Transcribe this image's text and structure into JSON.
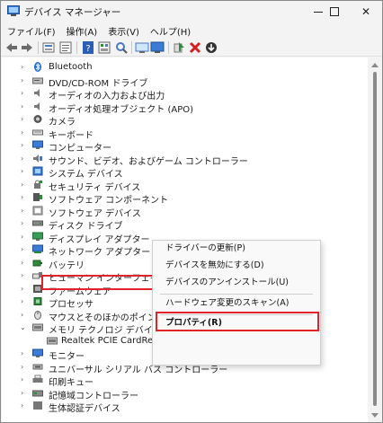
{
  "window": {
    "title": "デバイス マネージャー",
    "min_label": "—",
    "max_label": "□",
    "close_label": "✕"
  },
  "menubar": {
    "items": [
      "ファイル(F)",
      "操作(A)",
      "表示(V)",
      "ヘルプ(H)"
    ]
  },
  "toolbar": {
    "icons": [
      "back-arrow-icon",
      "forward-arrow-icon",
      "device-view-icon",
      "properties-icon",
      "help-icon",
      "resources-icon",
      "scan-hardware-icon",
      "monitor-icon",
      "enable-device-icon",
      "uninstall-icon",
      "update-driver-icon"
    ]
  },
  "tree": {
    "items": [
      {
        "label": "Bluetooth",
        "icon": "bluetooth-icon",
        "expanded": false
      },
      {
        "label": "DVD/CD-ROM ドライブ",
        "icon": "dvd-drive-icon",
        "expanded": false
      },
      {
        "label": "オーディオの入力および出力",
        "icon": "speaker-icon",
        "expanded": false
      },
      {
        "label": "オーディオ処理オブジェクト (APO)",
        "icon": "speaker-icon",
        "expanded": false
      },
      {
        "label": "カメラ",
        "icon": "camera-icon",
        "expanded": false
      },
      {
        "label": "キーボード",
        "icon": "keyboard-icon",
        "expanded": false
      },
      {
        "label": "コンピューター",
        "icon": "computer-icon",
        "expanded": false
      },
      {
        "label": "サウンド、ビデオ、およびゲーム コントローラー",
        "icon": "sound-video-icon",
        "expanded": false
      },
      {
        "label": "システム デバイス",
        "icon": "system-device-icon",
        "expanded": false
      },
      {
        "label": "セキュリティ デバイス",
        "icon": "security-device-icon",
        "expanded": false
      },
      {
        "label": "ソフトウェア コンポーネント",
        "icon": "software-component-icon",
        "expanded": false
      },
      {
        "label": "ソフトウェア デバイス",
        "icon": "software-device-icon",
        "expanded": false
      },
      {
        "label": "ディスク ドライブ",
        "icon": "disk-drive-icon",
        "expanded": false
      },
      {
        "label": "ディスプレイ アダプター",
        "icon": "display-adapter-icon",
        "expanded": false
      },
      {
        "label": "ネットワーク アダプター",
        "icon": "network-adapter-icon",
        "expanded": false
      },
      {
        "label": "バッテリ",
        "icon": "battery-icon",
        "expanded": false
      },
      {
        "label": "ヒューマン インターフェイス デバイ",
        "icon": "hid-icon",
        "expanded": false
      },
      {
        "label": "ファームウェア",
        "icon": "firmware-icon",
        "expanded": false
      },
      {
        "label": "プロセッサ",
        "icon": "processor-icon",
        "expanded": false
      },
      {
        "label": "マウスとそのほかのポインティン",
        "icon": "mouse-icon",
        "expanded": false
      },
      {
        "label": "メモリ テクノロジ デバイス",
        "icon": "memory-device-icon",
        "expanded": true
      },
      {
        "label": "Realtek PCIE CardReader",
        "icon": "card-reader-icon",
        "child": true
      },
      {
        "label": "モニター",
        "icon": "monitor-icon",
        "expanded": false
      },
      {
        "label": "ユニバーサル シリアル バス コントローラー",
        "icon": "usb-controller-icon",
        "expanded": false
      },
      {
        "label": "印刷キュー",
        "icon": "printer-icon",
        "expanded": false
      },
      {
        "label": "記憶域コントローラー",
        "icon": "storage-controller-icon",
        "expanded": false
      },
      {
        "label": "生体認証デバイス",
        "icon": "biometric-icon",
        "expanded": false
      }
    ]
  },
  "context_menu": {
    "update_driver": "ドライバーの更新(P)",
    "disable_device": "デバイスを無効にする(D)",
    "uninstall_device": "デバイスのアンインストール(U)",
    "scan_hardware": "ハードウェア変更のスキャン(A)",
    "properties": "プロパティ(R)"
  },
  "colors": {
    "highlight": "#e0242a",
    "background": "#ffffff",
    "chrome": "#f3f3f3"
  }
}
